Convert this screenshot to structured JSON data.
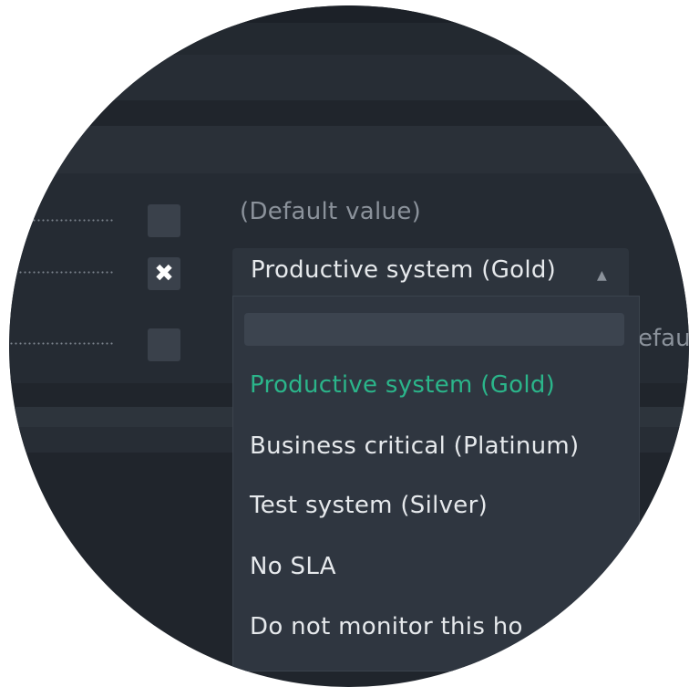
{
  "rows": [
    {
      "checked": false,
      "value": "(Default value)"
    },
    {
      "checked": true,
      "check_glyph": "✖"
    },
    {
      "checked": false,
      "partial_value": "efau"
    }
  ],
  "select": {
    "value": "Productive system (Gold)",
    "arrow_icon": "▲",
    "search_placeholder": "",
    "options": [
      "Productive system (Gold)",
      "Business critical (Platinum)",
      "Test system (Silver)",
      "No SLA",
      "Do not monitor this ho"
    ],
    "selected_index": 0
  },
  "colors": {
    "background": "#20252c",
    "dropdown": "#2f3640",
    "selected_option": "#2bb58a",
    "text": "#e6e9ec",
    "muted_text": "#8b929b"
  }
}
